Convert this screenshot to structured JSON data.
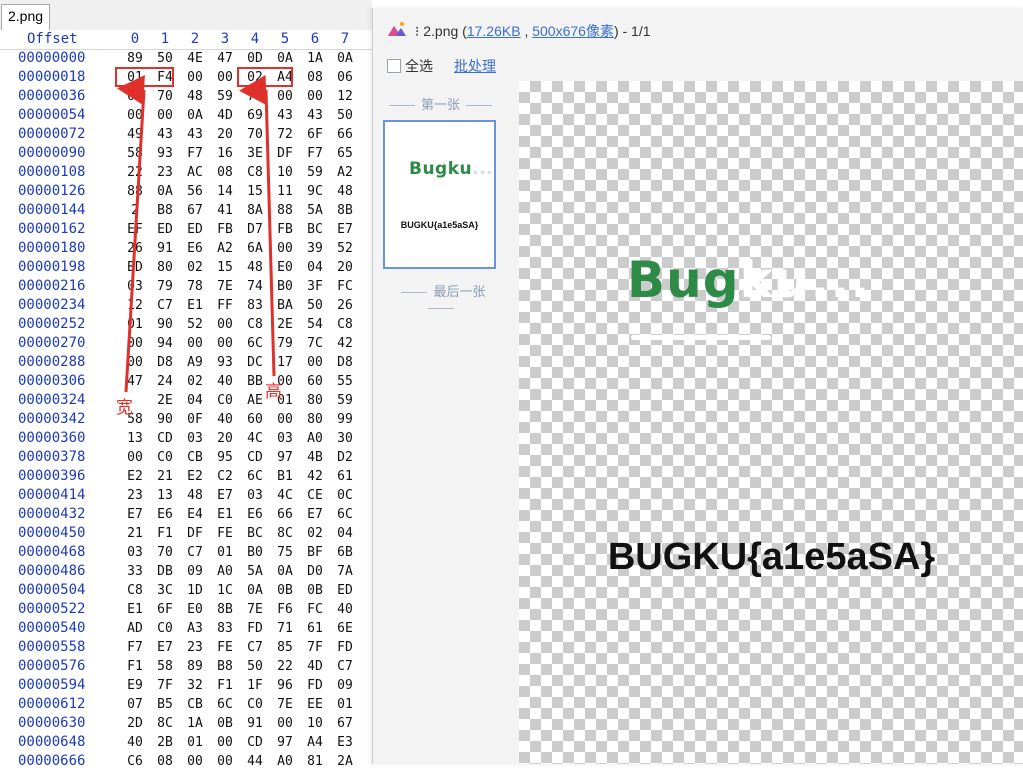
{
  "hex_editor": {
    "tab_label": "2.png",
    "header": {
      "offset_label": "Offset",
      "columns": [
        "0",
        "1",
        "2",
        "3",
        "4",
        "5",
        "6",
        "7"
      ]
    },
    "rows": [
      {
        "offset": "00000000",
        "bytes": [
          "89",
          "50",
          "4E",
          "47",
          "0D",
          "0A",
          "1A",
          "0A"
        ]
      },
      {
        "offset": "00000018",
        "bytes": [
          "01",
          "F4",
          "00",
          "00",
          "02",
          "A4",
          "08",
          "06"
        ]
      },
      {
        "offset": "00000036",
        "bytes": [
          "09",
          "70",
          "48",
          "59",
          "73",
          "00",
          "00",
          "12"
        ]
      },
      {
        "offset": "00000054",
        "bytes": [
          "00",
          "00",
          "0A",
          "4D",
          "69",
          "43",
          "43",
          "50"
        ]
      },
      {
        "offset": "00000072",
        "bytes": [
          "49",
          "43",
          "43",
          "20",
          "70",
          "72",
          "6F",
          "66"
        ]
      },
      {
        "offset": "00000090",
        "bytes": [
          "58",
          "93",
          "F7",
          "16",
          "3E",
          "DF",
          "F7",
          "65"
        ]
      },
      {
        "offset": "00000108",
        "bytes": [
          "22",
          "23",
          "AC",
          "08",
          "C8",
          "10",
          "59",
          "A2"
        ]
      },
      {
        "offset": "00000126",
        "bytes": [
          "88",
          "0A",
          "56",
          "14",
          "15",
          "11",
          "9C",
          "48"
        ]
      },
      {
        "offset": "00000144",
        "bytes": [
          "2",
          "B8",
          "67",
          "41",
          "8A",
          "88",
          "5A",
          "8B"
        ]
      },
      {
        "offset": "00000162",
        "bytes": [
          "EF",
          "ED",
          "ED",
          "FB",
          "D7",
          "FB",
          "BC",
          "E7"
        ]
      },
      {
        "offset": "00000180",
        "bytes": [
          "26",
          "91",
          "E6",
          "A2",
          "6A",
          "00",
          "39",
          "52"
        ]
      },
      {
        "offset": "00000198",
        "bytes": [
          "BD",
          "80",
          "02",
          "15",
          "48",
          "E0",
          "04",
          "20"
        ]
      },
      {
        "offset": "00000216",
        "bytes": [
          "03",
          "79",
          "78",
          "7E",
          "74",
          "B0",
          "3F",
          "FC"
        ]
      },
      {
        "offset": "00000234",
        "bytes": [
          "12",
          "C7",
          "E1",
          "FF",
          "83",
          "BA",
          "50",
          "26"
        ]
      },
      {
        "offset": "00000252",
        "bytes": [
          "01",
          "90",
          "52",
          "00",
          "C8",
          "2E",
          "54",
          "C8"
        ]
      },
      {
        "offset": "00000270",
        "bytes": [
          "00",
          "94",
          "00",
          "00",
          "6C",
          "79",
          "7C",
          "42"
        ]
      },
      {
        "offset": "00000288",
        "bytes": [
          "00",
          "D8",
          "A9",
          "93",
          "DC",
          "17",
          "00",
          "D8"
        ]
      },
      {
        "offset": "00000306",
        "bytes": [
          "47",
          "24",
          "02",
          "40",
          "BB",
          "00",
          "60",
          "55"
        ]
      },
      {
        "offset": "00000324",
        "bytes": [
          "",
          "2E",
          "04",
          "C0",
          "AE",
          "01",
          "80",
          "59"
        ]
      },
      {
        "offset": "00000342",
        "bytes": [
          "58",
          "90",
          "0F",
          "40",
          "60",
          "00",
          "80",
          "99"
        ]
      },
      {
        "offset": "00000360",
        "bytes": [
          "13",
          "CD",
          "03",
          "20",
          "4C",
          "03",
          "A0",
          "30"
        ]
      },
      {
        "offset": "00000378",
        "bytes": [
          "00",
          "C0",
          "CB",
          "95",
          "CD",
          "97",
          "4B",
          "D2"
        ]
      },
      {
        "offset": "00000396",
        "bytes": [
          "E2",
          "21",
          "E2",
          "C2",
          "6C",
          "B1",
          "42",
          "61"
        ]
      },
      {
        "offset": "00000414",
        "bytes": [
          "23",
          "13",
          "48",
          "E7",
          "03",
          "4C",
          "CE",
          "0C"
        ]
      },
      {
        "offset": "00000432",
        "bytes": [
          "E7",
          "E6",
          "E4",
          "E1",
          "E6",
          "66",
          "E7",
          "6C"
        ]
      },
      {
        "offset": "00000450",
        "bytes": [
          "21",
          "F1",
          "DF",
          "FE",
          "BC",
          "8C",
          "02",
          "04"
        ]
      },
      {
        "offset": "00000468",
        "bytes": [
          "03",
          "70",
          "C7",
          "01",
          "B0",
          "75",
          "BF",
          "6B"
        ]
      },
      {
        "offset": "00000486",
        "bytes": [
          "33",
          "DB",
          "09",
          "A0",
          "5A",
          "0A",
          "D0",
          "7A"
        ]
      },
      {
        "offset": "00000504",
        "bytes": [
          "C8",
          "3C",
          "1D",
          "1C",
          "0A",
          "0B",
          "0B",
          "ED"
        ]
      },
      {
        "offset": "00000522",
        "bytes": [
          "E1",
          "6F",
          "E0",
          "8B",
          "7E",
          "F6",
          "FC",
          "40"
        ]
      },
      {
        "offset": "00000540",
        "bytes": [
          "AD",
          "C0",
          "A3",
          "83",
          "FD",
          "71",
          "61",
          "6E"
        ]
      },
      {
        "offset": "00000558",
        "bytes": [
          "F7",
          "E7",
          "23",
          "FE",
          "C7",
          "85",
          "7F",
          "FD"
        ]
      },
      {
        "offset": "00000576",
        "bytes": [
          "F1",
          "58",
          "89",
          "B8",
          "50",
          "22",
          "4D",
          "C7"
        ]
      },
      {
        "offset": "00000594",
        "bytes": [
          "E9",
          "7F",
          "32",
          "F1",
          "1F",
          "96",
          "FD",
          "09"
        ]
      },
      {
        "offset": "00000612",
        "bytes": [
          "07",
          "B5",
          "CB",
          "6C",
          "C0",
          "7E",
          "EE",
          "01"
        ]
      },
      {
        "offset": "00000630",
        "bytes": [
          "2D",
          "8C",
          "1A",
          "0B",
          "91",
          "00",
          "10",
          "67"
        ]
      },
      {
        "offset": "00000648",
        "bytes": [
          "40",
          "2B",
          "01",
          "00",
          "CD",
          "97",
          "A4",
          "E3"
        ]
      },
      {
        "offset": "00000666",
        "bytes": [
          "C6",
          "08",
          "00",
          "00",
          "44",
          "A0",
          "81",
          "2A"
        ]
      }
    ],
    "annotations": {
      "width_label": "宽",
      "height_label": "高"
    }
  },
  "viewer": {
    "filename": "2.png",
    "title_prefix": "(",
    "filesize": "17.26KB",
    "title_sep": " , ",
    "dimensions": "500x676像素",
    "title_suffix": ") - 1/1",
    "select_all_label": "全选",
    "batch_label": "批处理",
    "first_label": "第一张",
    "last_label": "最后一张",
    "thumb_logo": "Bugku",
    "thumb_logo_dots": "...",
    "thumb_text": "BUGKU{a1e5aSA}",
    "logo_main": "Bug",
    "logo_white": "ku...",
    "flag_text": "BUGKU{a1e5aSA}"
  },
  "colors": {
    "offset_blue": "#1c3bb8",
    "annotation_red": "#e0302c",
    "logo_green": "#2e8b47",
    "link_blue": "#3b6fd4"
  }
}
